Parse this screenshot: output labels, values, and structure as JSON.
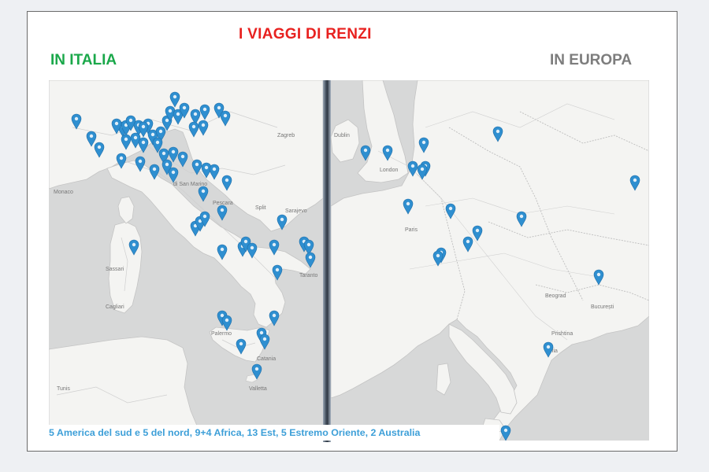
{
  "title": "I VIAGGI DI RENZI",
  "left_panel": {
    "label": "IN ITALIA"
  },
  "right_panel": {
    "label": "IN EUROPA"
  },
  "caption": "5 America del sud e 5 del nord, 9+4 Africa, 13 Est, 5 Estremo Oriente, 2 Australia",
  "colors": {
    "title": "#e8211f",
    "italy_label": "#1aa84a",
    "europe_label": "#7d7d7d",
    "caption": "#3d9fd8",
    "marker": "#2f8fd0",
    "land": "#f4f4f2",
    "sea": "#d7d8d8"
  },
  "italy_map_labels": {
    "zagreb": "Zagreb",
    "sarajevo": "Sarajevo",
    "monaco": "Monaco",
    "split": "Split",
    "pescara": "Pescara",
    "san_marino": "di San Marino",
    "sassari": "Sassari",
    "cagliari": "Cagliari",
    "palermo": "Palermo",
    "catania": "Catania",
    "taranto": "Taranto",
    "valletta": "Valletta",
    "tunis": "Tunis"
  },
  "europe_map_labels": {
    "dublin": "Dublin",
    "london": "London",
    "paris": "Paris",
    "bucuresti": "București",
    "beograd": "Beograd",
    "prishtina": "Prishtina",
    "sofia": "Sofia"
  },
  "marker_icon": "map-pin-icon"
}
